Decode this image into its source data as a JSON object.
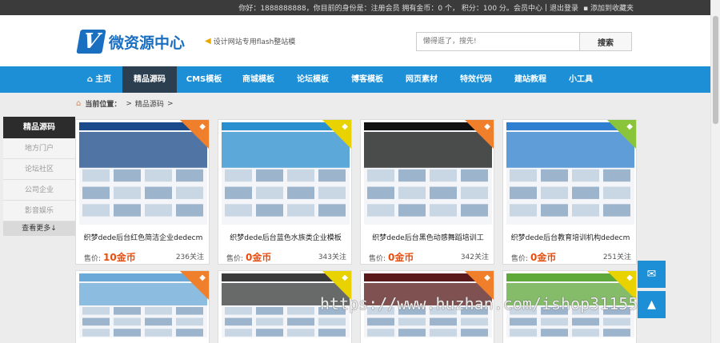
{
  "topbar": {
    "greeting": "你好：1888888888，你目前的身份是：注册会员 拥有金币：0 个， 积分：100 分。",
    "member_center": "会员中心",
    "sep": "|",
    "logout": "退出登录",
    "favorite": "添加到收藏夹"
  },
  "header": {
    "logo_letter": "V",
    "logo_text": "微资源中心",
    "slogan": "设计网站专用flash整站模",
    "search_placeholder": "懒得逛了，搜先!",
    "search_button": "搜索"
  },
  "nav": {
    "items": [
      {
        "label": "主页",
        "icon": "home-icon"
      },
      {
        "label": "精品源码"
      },
      {
        "label": "CMS模板"
      },
      {
        "label": "商城模板"
      },
      {
        "label": "论坛模板"
      },
      {
        "label": "博客模板"
      },
      {
        "label": "网页素材"
      },
      {
        "label": "特效代码"
      },
      {
        "label": "建站教程"
      },
      {
        "label": "小工具"
      }
    ]
  },
  "breadcrumb": {
    "label": "当前位置：",
    "sep1": ">",
    "current": "精品源码",
    "sep2": ">"
  },
  "sidebar": {
    "title": "精品源码",
    "items": [
      "地方门户",
      "论坛社区",
      "公司企业",
      "影音娱乐"
    ],
    "more": "查看更多↓"
  },
  "products": [
    {
      "title": "织梦dede后台红色简洁企业dedecm",
      "price_label": "售价:",
      "price": "10金币",
      "follows": "236关注",
      "badge_color": "#f07f2c",
      "theme": "#1a4a8a"
    },
    {
      "title": "织梦dede后台蓝色水族类企业模板",
      "price_label": "售价:",
      "price": "0金币",
      "follows": "343关注",
      "badge_color": "#e8d200",
      "theme": "#2a8fcf"
    },
    {
      "title": "织梦dede后台黑色动感舞蹈培训工",
      "price_label": "售价:",
      "price": "0金币",
      "follows": "342关注",
      "badge_color": "#f07f2c",
      "theme": "#111111"
    },
    {
      "title": "织梦dede后台教育培训机构dedecm",
      "price_label": "售价:",
      "price": "0金币",
      "follows": "251关注",
      "badge_color": "#8ac43a",
      "theme": "#2e7fcf"
    },
    {
      "badge_color": "#f07f2c",
      "theme": "#6aa9d8"
    },
    {
      "badge_color": "#e8d200",
      "theme": "#3a3a3a"
    },
    {
      "badge_color": "#f07f2c",
      "theme": "#5a1a1a"
    },
    {
      "badge_color": "#e8d200",
      "theme": "#5fa83a"
    }
  ],
  "float_buttons": [
    "mail-icon",
    "arrow-icon"
  ],
  "watermark": "https://www.huzhan.com/ishop31155",
  "colors": {
    "nav": "#1d8fd6",
    "nav_active": "#2c3f50",
    "price": "#e84d0e",
    "topbar": "#3b3b3b"
  }
}
